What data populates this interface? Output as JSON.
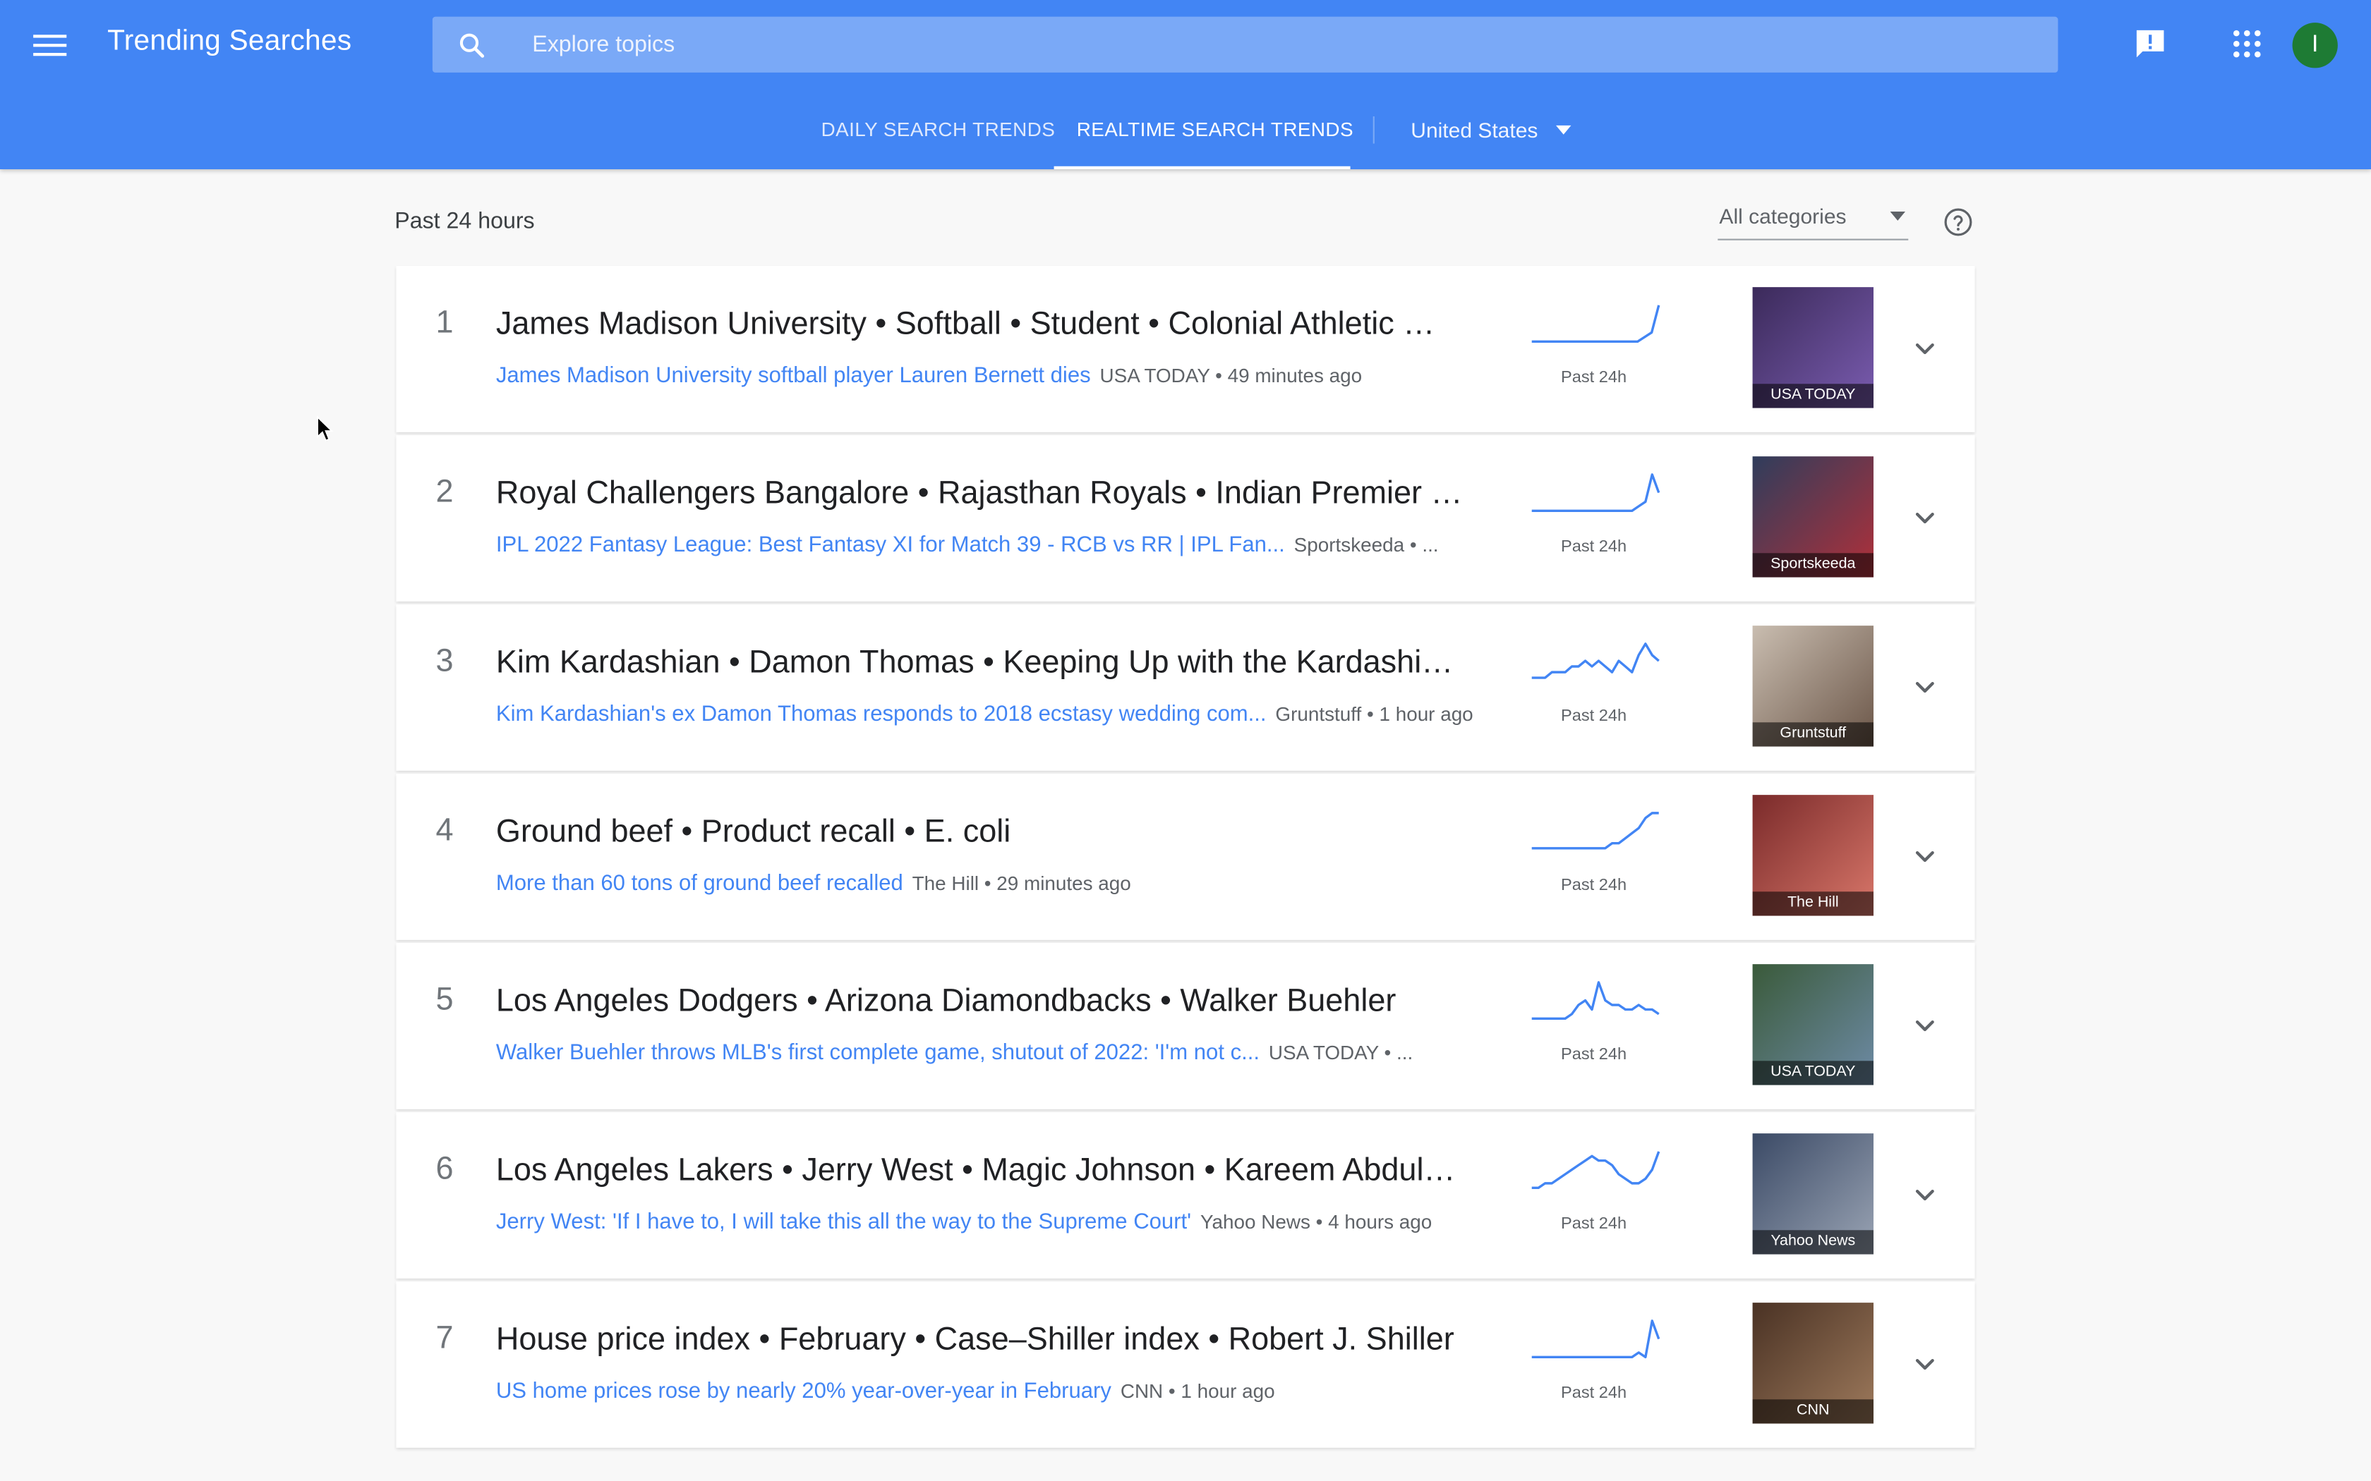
{
  "header": {
    "app_title": "Trending Searches",
    "search_placeholder": "Explore topics",
    "icons": [
      "menu-icon",
      "search-icon",
      "feedback-icon",
      "apps-grid-icon"
    ],
    "avatar_letter": "I",
    "accent_color": "#4285f4"
  },
  "tabs": {
    "daily": "DAILY SEARCH TRENDS",
    "realtime": "REALTIME SEARCH TRENDS",
    "active": "realtime",
    "geo": "United States"
  },
  "filters": {
    "period": "Past 24 hours",
    "category": "All categories"
  },
  "items": [
    {
      "rank": "1",
      "title": "James Madison University • Softball • Student • Colonial Athletic …",
      "article": "James Madison University softball player Lauren Bernett dies",
      "source": "USA TODAY • 49 minutes ago",
      "spark_label": "Past 24h",
      "thumb_caption": "USA TODAY",
      "trend": [
        2,
        2,
        2,
        2,
        2,
        2,
        2,
        2,
        2,
        2,
        2,
        2,
        2,
        2,
        2,
        2,
        3,
        4,
        10
      ]
    },
    {
      "rank": "2",
      "title": "Royal Challengers Bangalore • Rajasthan Royals • Indian Premier …",
      "article": "IPL 2022 Fantasy League: Best Fantasy XI for Match 39 - RCB vs RR | IPL Fan...",
      "source": "Sportskeeda • ...",
      "spark_label": "Past 24h",
      "thumb_caption": "Sportskeeda",
      "trend": [
        2,
        2,
        2,
        2,
        2,
        2,
        2,
        2,
        2,
        2,
        2,
        2,
        2,
        2,
        2,
        2,
        3,
        4,
        10,
        6
      ]
    },
    {
      "rank": "3",
      "title": "Kim Kardashian • Damon Thomas • Keeping Up with the Kardashi…",
      "article": "Kim Kardashian's ex Damon Thomas responds to 2018 ecstasy wedding com...",
      "source": "Gruntstuff • 1 hour ago",
      "spark_label": "Past 24h",
      "thumb_caption": "Gruntstuff",
      "trend": [
        2,
        2,
        2,
        3,
        3,
        3,
        4,
        4,
        5,
        4,
        5,
        4,
        3,
        5,
        4,
        3,
        6,
        8,
        6,
        5
      ]
    },
    {
      "rank": "4",
      "title": "Ground beef • Product recall • E. coli",
      "article": "More than 60 tons of ground beef recalled",
      "source": "The Hill • 29 minutes ago",
      "spark_label": "Past 24h",
      "thumb_caption": "The Hill",
      "trend": [
        2,
        2,
        2,
        2,
        2,
        2,
        2,
        2,
        2,
        2,
        2,
        2,
        3,
        3,
        4,
        5,
        6,
        8,
        9,
        9
      ]
    },
    {
      "rank": "5",
      "title": "Los Angeles Dodgers • Arizona Diamondbacks • Walker Buehler",
      "article": "Walker Buehler throws MLB's first complete game, shutout of 2022: 'I'm not c...",
      "source": "USA TODAY • ...",
      "spark_label": "Past 24h",
      "thumb_caption": "USA TODAY",
      "trend": [
        2,
        2,
        2,
        2,
        2,
        2,
        3,
        5,
        6,
        4,
        10,
        6,
        5,
        5,
        4,
        4,
        5,
        4,
        4,
        3
      ]
    },
    {
      "rank": "6",
      "title": "Los Angeles Lakers • Jerry West • Magic Johnson • Kareem Abdul…",
      "article": "Jerry West: 'If I have to, I will take this all the way to the Supreme Court'",
      "source": "Yahoo News • 4 hours ago",
      "spark_label": "Past 24h",
      "thumb_caption": "Yahoo News",
      "trend": [
        2,
        2,
        3,
        3,
        4,
        5,
        6,
        7,
        8,
        9,
        8,
        8,
        7,
        5,
        4,
        3,
        3,
        4,
        6,
        10
      ]
    },
    {
      "rank": "7",
      "title": "House price index • February • Case–Shiller index • Robert J. Shiller",
      "article": "US home prices rose by nearly 20% year-over-year in February",
      "source": "CNN • 1 hour ago",
      "spark_label": "Past 24h",
      "thumb_caption": "CNN",
      "trend": [
        2,
        2,
        2,
        2,
        2,
        2,
        2,
        2,
        2,
        2,
        2,
        2,
        2,
        2,
        2,
        2,
        3,
        2,
        10,
        6
      ]
    }
  ]
}
